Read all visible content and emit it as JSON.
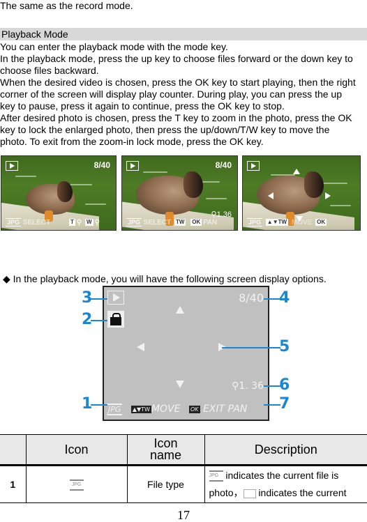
{
  "intro_line": "The same as the record mode.",
  "section": {
    "title": "Playback Mode",
    "paragraphs": [
      "You can enter the playback mode with the mode key.",
      "In the playback mode, press the up key to choose files forward or the down key to",
      "choose files backward.",
      "When the desired video is chosen, press the OK key to start playing, then the right",
      "corner of the screen will display play counter. During play, you can press the up",
      "key to pause, press it again to continue, press the OK key to stop.",
      "After desired photo is chosen, press the T key to zoom in the photo, press the OK",
      "key to lock the enlarged photo, then press the up/down/T/W key to move the",
      "photo. To exit from the zoom-in lock mode, press the OK key."
    ]
  },
  "screens": [
    {
      "counter": "8/40",
      "file_type": "JPG",
      "hint": "SELECT",
      "keys": [
        "T",
        "W"
      ]
    },
    {
      "counter": "8/40",
      "zoom": "1.36",
      "file_type": "JPG",
      "hint": "SELECT",
      "keys": [
        "TW",
        "OK"
      ],
      "extra": "PAN"
    },
    {
      "file_type": "JPG",
      "keys": [
        "▲▼TW",
        "OK"
      ],
      "hint": "MOVE"
    }
  ],
  "bullet": {
    "symbol": "◆",
    "text": "In the playback mode, you will have the following screen display options."
  },
  "diagram": {
    "counter": "8/40",
    "zoom_value": "1. 36",
    "file_type": "JPG",
    "move_key": "▲▼TW",
    "move_label": "MOVE",
    "ok_key": "OK",
    "exit_label": "EXIT PAN",
    "callouts": [
      "1",
      "2",
      "3",
      "4",
      "5",
      "6",
      "7"
    ],
    "accent_color": "#1a87d0"
  },
  "table": {
    "headers": [
      "",
      "Icon",
      "Icon name",
      "Description"
    ],
    "rows": [
      {
        "num": "1",
        "icon": "JPG",
        "name": "File type",
        "desc_part1": " indicates the current file is",
        "desc_part2_prefix": "photo，",
        "desc_part2": " indicates the current"
      }
    ]
  },
  "page_number": "17"
}
